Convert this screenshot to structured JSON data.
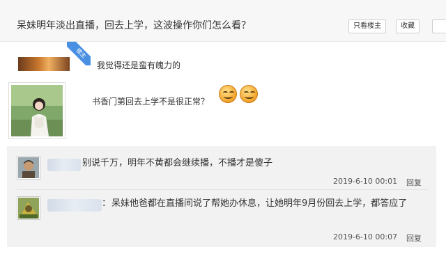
{
  "header": {
    "title": "呆妹明年淡出直播，回去上学，这波操作你们怎么看？",
    "only_owner_label": "只看楼主",
    "favorite_label": "收藏"
  },
  "post": {
    "badge": "楼主",
    "text1": "我觉得还是蛮有魄力的",
    "text2": "书香门第回去上学不是很正常？"
  },
  "comments": [
    {
      "text": "别说千万，明年不黄都会继续播，不播才是傻子",
      "time": "2019-6-10 00:01",
      "reply_label": "回复"
    },
    {
      "user_suffix": "：",
      "text": "呆妹他爸都在直播间说了帮她办休息，让她明年9月份回去上学，都答应了",
      "time": "2019-6-10 00:07",
      "reply_label": "回复"
    }
  ]
}
